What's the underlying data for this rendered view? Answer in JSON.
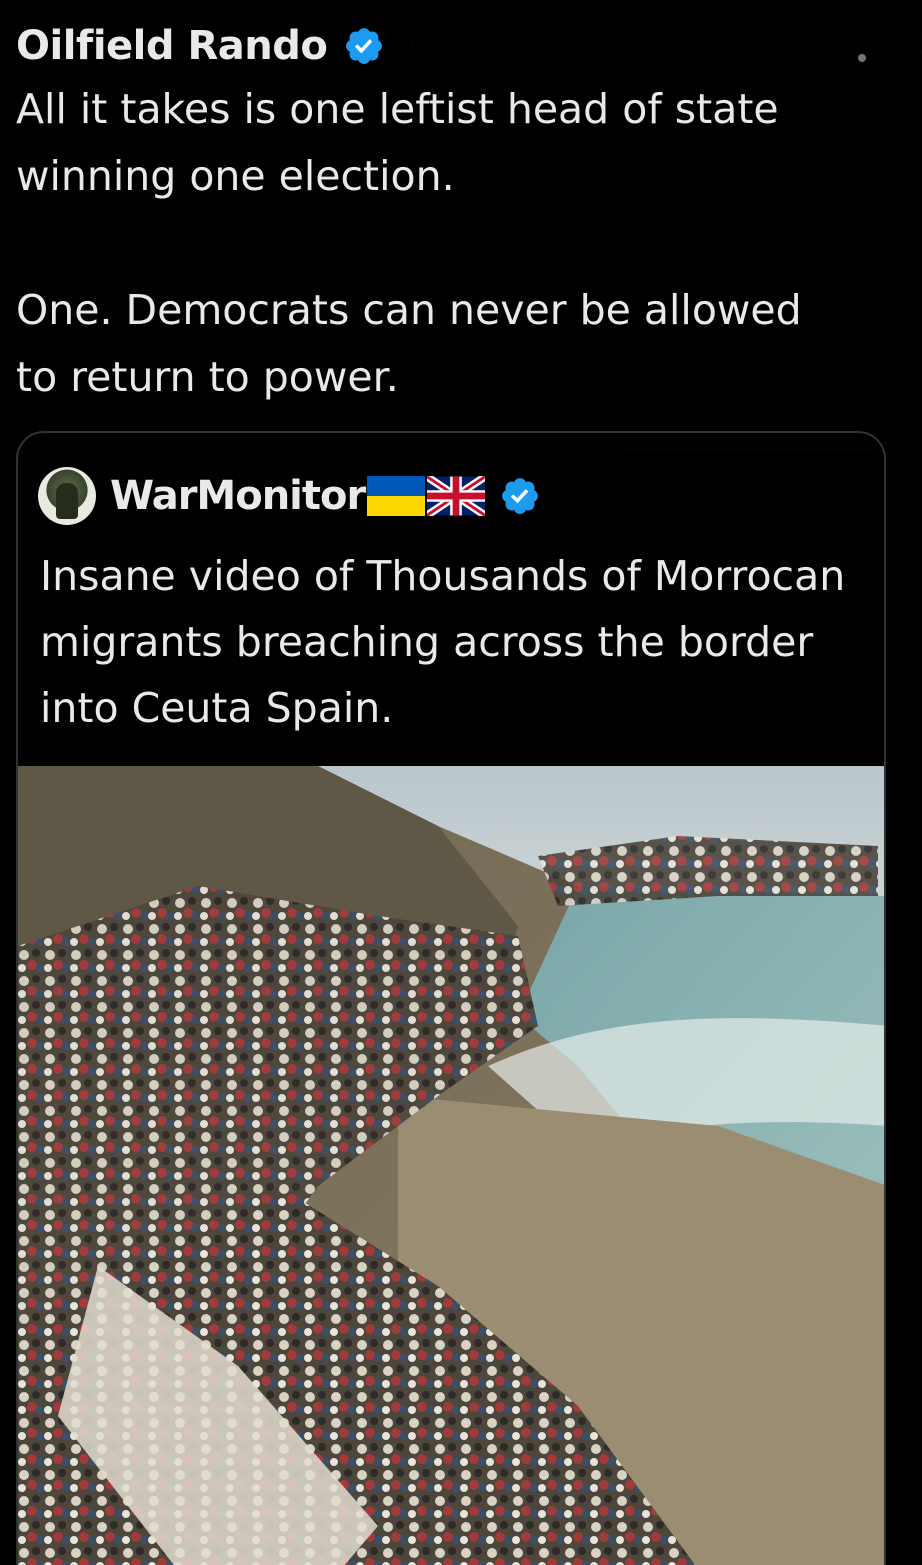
{
  "tweet": {
    "author_name": "Oilfield Rando",
    "text": "All it takes is one leftist head of state\nwinning one election.\n\nOne. Democrats can never be allowed\nto return to power."
  },
  "quote": {
    "author_name": "WarMonitor",
    "flags": [
      "ukraine-flag-icon",
      "uk-flag-icon"
    ],
    "text": "Insane video of Thousands of Morrocan migrants breaching across the border into Ceuta Spain."
  },
  "colors": {
    "background": "#000000",
    "text": "#e7e9ea",
    "verified_badge": "#1d9bf0",
    "quote_border": "#2f3336"
  },
  "icons": {
    "verified": "verified-badge-icon",
    "more": "more-icon"
  }
}
